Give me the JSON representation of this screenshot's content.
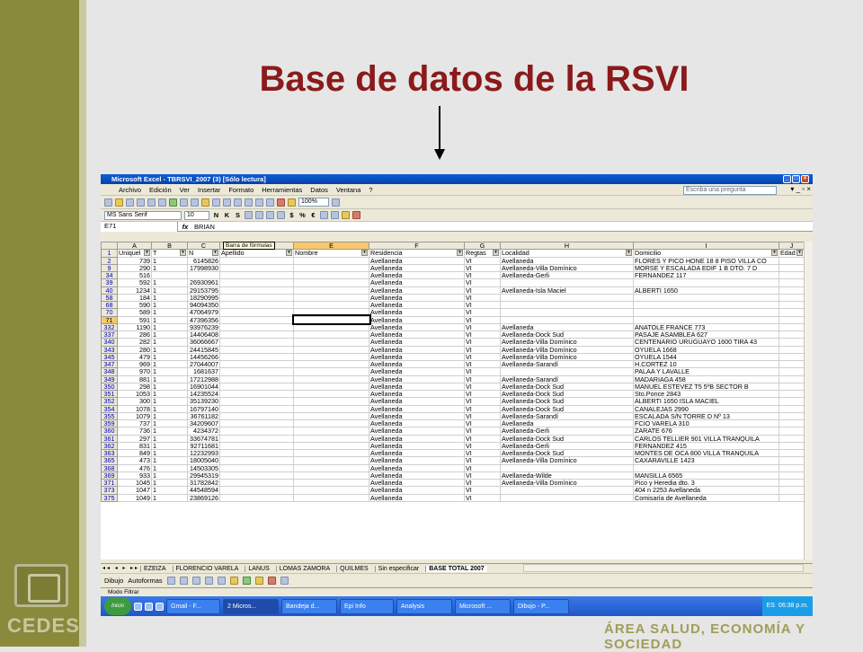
{
  "slide": {
    "title": "Base de datos de la RSVI",
    "logo_text": "CEDES",
    "footer": "ÁREA SALUD, ECONOMÍA Y SOCIEDAD"
  },
  "excel": {
    "window_title": "Microsoft Excel - TBRSVI_2007 (3)  [Sólo lectura]",
    "menu": [
      "Archivo",
      "Edición",
      "Ver",
      "Insertar",
      "Formato",
      "Herramientas",
      "Datos",
      "Ventana",
      "?"
    ],
    "help_placeholder": "Escriba una pregunta",
    "zoom": "100%",
    "font": "MS Sans Serif",
    "font_size": "10",
    "name_box": "E71",
    "fx": "fx",
    "formula_value": "BRIAN",
    "tooltip": "Barra de fórmulas",
    "col_letters": [
      "",
      "A",
      "B",
      "C",
      "D",
      "E",
      "F",
      "G",
      "H",
      "I",
      "J"
    ],
    "headers": [
      "Uniquel",
      "T",
      "N",
      "Apellido",
      "Nombre",
      "Residencia",
      "Regtas",
      "Localidad",
      "Domicilio",
      "Edad"
    ],
    "rows": [
      [
        "2",
        "739",
        "1",
        "6145826",
        "",
        "",
        "Avellaneda",
        "VI",
        "Avellaneda",
        "FLORES Y PICO HONE 18 8 PISO VILLA CO"
      ],
      [
        "9",
        "290",
        "1",
        "17998930",
        "",
        "",
        "Avellaneda",
        "VI",
        "Avellaneda-Villa Domínico",
        "MORSE Y ESCALADA EDIF 1 B DTO. 7 D"
      ],
      [
        "34",
        "516",
        "",
        "",
        "",
        "",
        "Avellaneda",
        "VI",
        "Avellaneda-Gerli",
        "FERNANDEZ 117"
      ],
      [
        "39",
        "592",
        "1",
        "26930961",
        "",
        "",
        "Avellaneda",
        "VI",
        "",
        ""
      ],
      [
        "40",
        "1234",
        "1",
        "29153795",
        "",
        "",
        "Avellaneda",
        "VI",
        "Avellaneda-Isla Maciel",
        "ALBERTI 1650"
      ],
      [
        "58",
        "184",
        "1",
        "18290995",
        "",
        "",
        "Avellaneda",
        "VI",
        "",
        ""
      ],
      [
        "68",
        "590",
        "1",
        "94094350",
        "",
        "",
        "Avellaneda",
        "VI",
        "",
        ""
      ],
      [
        "70",
        "589",
        "1",
        "47064979",
        "",
        "",
        "Avellaneda",
        "VI",
        "",
        ""
      ],
      [
        "71",
        "591",
        "1",
        "47396356",
        "",
        "",
        "Avellaneda",
        "VI",
        "",
        ""
      ],
      [
        "332",
        "1190",
        "1",
        "93976239",
        "",
        "",
        "Avellaneda",
        "VI",
        "Avellaneda",
        "ANATOLE FRANCE 773"
      ],
      [
        "337",
        "286",
        "1",
        "14406408",
        "",
        "",
        "Avellaneda",
        "VI",
        "Avellaneda-Dock Sud",
        "PASAJE ASAMBLEA 627"
      ],
      [
        "340",
        "282",
        "1",
        "36066667",
        "",
        "",
        "Avellaneda",
        "VI",
        "Avellaneda-Villa Domínico",
        "CENTENARIO URUGUAYO 1600 TIRA 43"
      ],
      [
        "343",
        "280",
        "1",
        "24415845",
        "",
        "",
        "Avellaneda",
        "VI",
        "Avellaneda-Villa Domínico",
        "OYUELA 1668"
      ],
      [
        "345",
        "479",
        "1",
        "14456266",
        "",
        "",
        "Avellaneda",
        "VI",
        "Avellaneda-Villa Domínico",
        "OYUELA 1544"
      ],
      [
        "347",
        "969",
        "1",
        "27044007",
        "",
        "",
        "Avellaneda",
        "VI",
        "Avellaneda-Sarandí",
        "H.CORTEZ 10"
      ],
      [
        "348",
        "970",
        "1",
        "1681637",
        "",
        "",
        "Avellaneda",
        "VI",
        "",
        "PALAA Y LAVALLE"
      ],
      [
        "349",
        "881",
        "1",
        "17212988",
        "",
        "",
        "Avellaneda",
        "VI",
        "Avellaneda-Sarandí",
        "MADARIAGA 458"
      ],
      [
        "350",
        "298",
        "1",
        "16901044",
        "",
        "",
        "Avellaneda",
        "VI",
        "Avellaneda-Dock Sud",
        "MANUEL ESTEVEZ T5 5ºB SECTOR B"
      ],
      [
        "351",
        "1053",
        "1",
        "14235524",
        "",
        "",
        "Avellaneda",
        "VI",
        "Avellaneda-Dock Sud",
        "Sto.Ponce 2843"
      ],
      [
        "352",
        "300",
        "1",
        "35139230",
        "",
        "",
        "Avellaneda",
        "VI",
        "Avellaneda-Dock Sud",
        "ALBERTI 1650 ISLA MACIEL"
      ],
      [
        "354",
        "1078",
        "1",
        "16797140",
        "",
        "",
        "Avellaneda",
        "VI",
        "Avellaneda-Dock Sud",
        "CANALEJAS 2990"
      ],
      [
        "355",
        "1079",
        "1",
        "36761182",
        "",
        "",
        "Avellaneda",
        "VI",
        "Avellaneda-Sarandí",
        "ESCALADA S/N TORRE D Nº 13"
      ],
      [
        "359",
        "737",
        "1",
        "34209607",
        "",
        "",
        "Avellaneda",
        "VI",
        "Avellaneda",
        "FCIO VARELA 310"
      ],
      [
        "360",
        "736",
        "1",
        "4234372",
        "",
        "",
        "Avellaneda",
        "VI",
        "Avellaneda-Gerli",
        "ZARATE 676"
      ],
      [
        "361",
        "297",
        "1",
        "33674781",
        "",
        "",
        "Avellaneda",
        "VI",
        "Avellaneda-Dock Sud",
        "CARLOS TELLIER 901 VILLA TRANQUILA"
      ],
      [
        "362",
        "831",
        "1",
        "92711681",
        "",
        "",
        "Avellaneda",
        "VI",
        "Avellaneda-Gerli",
        "FERNANDEZ 415"
      ],
      [
        "363",
        "849",
        "1",
        "12232993",
        "",
        "",
        "Avellaneda",
        "VI",
        "Avellaneda-Dock Sud",
        "MONTES DE OCA 800 VILLA TRANQUILA"
      ],
      [
        "365",
        "473",
        "1",
        "18005040",
        "",
        "",
        "Avellaneda",
        "VI",
        "Avellaneda-Villa Domínico",
        "CAXARAVILLE 1423"
      ],
      [
        "368",
        "476",
        "1",
        "14503305",
        "",
        "",
        "Avellaneda",
        "VI",
        "",
        ""
      ],
      [
        "369",
        "933",
        "1",
        "29945319",
        "",
        "",
        "Avellaneda",
        "VI",
        "Avellaneda-Wilde",
        "MANSILLA 6565"
      ],
      [
        "371",
        "1045",
        "1",
        "31782842",
        "",
        "",
        "Avellaneda",
        "VI",
        "Avellaneda-Villa Domínico",
        "Pico y Heredia dto. 3"
      ],
      [
        "373",
        "1047",
        "1",
        "44548594",
        "",
        "",
        "Avellaneda",
        "VI",
        "",
        "404 n 2253 Avellaneda"
      ],
      [
        "375",
        "1049",
        "1",
        "23869126",
        "",
        "",
        "Avellaneda",
        "VI",
        "",
        "Comisaría de Avellaneda"
      ]
    ],
    "sheet_tabs": [
      "EZEIZA",
      "FLORENCIO VARELA",
      "LANUS",
      "LOMAS ZAMORA",
      "QUILMES",
      "Sin especificar",
      "BASE TOTAL 2007"
    ],
    "draw_label": "Dibujo",
    "autoshapes_label": "Autoformas",
    "status": "Modo Filtrar",
    "taskbar": {
      "start": "Inicio",
      "tasks": [
        "Gmail - F...",
        "2 Micros...",
        "Bandeja d...",
        "Epi Info",
        "Analysis",
        "Microsoft ...",
        "Dibujo - P..."
      ],
      "lang": "ES",
      "time": "06:38 p.m."
    }
  }
}
